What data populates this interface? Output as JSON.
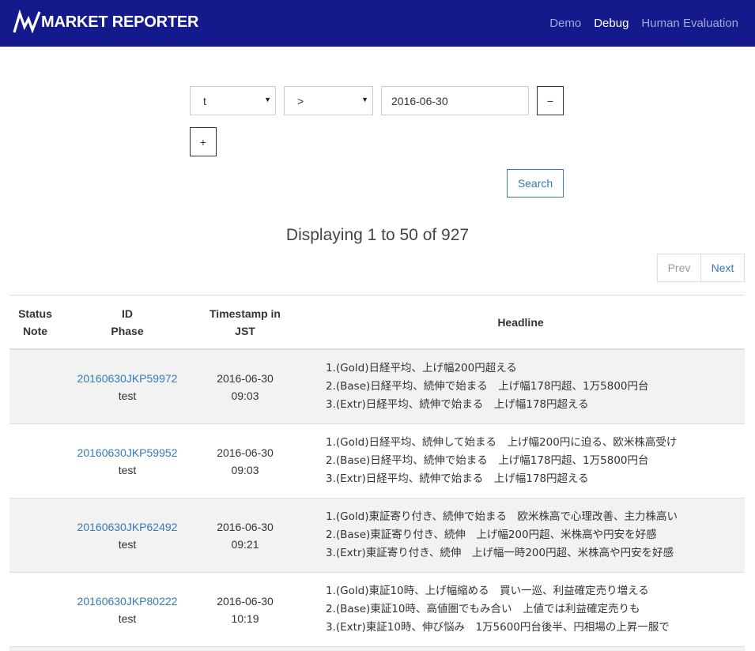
{
  "navbar": {
    "brand": "MARKET REPORTER",
    "brand_color": "#141a8c",
    "links": [
      {
        "label": "Demo"
      },
      {
        "label": "Debug"
      },
      {
        "label": "Human Evaluation"
      }
    ]
  },
  "filter": {
    "field_select": "t",
    "operator_select": ">",
    "date_value": "2016-06-30",
    "remove_label": "−",
    "add_label": "+",
    "search_label": "Search"
  },
  "results": {
    "display_text": "Displaying 1 to 50 of 927",
    "prev_label": "Prev",
    "next_label": "Next"
  },
  "table": {
    "headers": {
      "status": "Status",
      "note": "Note",
      "id": "ID",
      "phase": "Phase",
      "ts1": "Timestamp in",
      "ts2": "JST",
      "headline": "Headline"
    },
    "rows": [
      {
        "id": "20160630JKP59972",
        "phase": "test",
        "date": "2016-06-30",
        "time": "09:03",
        "headlines": [
          "1.(Gold)日経平均、上げ幅200円超える",
          "2.(Base)日経平均、続伸で始まる　上げ幅178円超、1万5800円台",
          "3.(Extr)日経平均、続伸で始まる　上げ幅178円超える"
        ]
      },
      {
        "id": "20160630JKP59952",
        "phase": "test",
        "date": "2016-06-30",
        "time": "09:03",
        "headlines": [
          "1.(Gold)日経平均、続伸して始まる　上げ幅200円に迫る、欧米株高受け",
          "2.(Base)日経平均、続伸で始まる　上げ幅178円超、1万5800円台",
          "3.(Extr)日経平均、続伸で始まる　上げ幅178円超える"
        ]
      },
      {
        "id": "20160630JKP62492",
        "phase": "test",
        "date": "2016-06-30",
        "time": "09:21",
        "headlines": [
          "1.(Gold)東証寄り付き、続伸で始まる　欧米株高で心理改善、主力株高い",
          "2.(Base)東証寄り付き、続伸　上げ幅200円超、米株高や円安を好感",
          "3.(Extr)東証寄り付き、続伸　上げ幅一時200円超、米株高や円安を好感"
        ]
      },
      {
        "id": "20160630JKP80222",
        "phase": "test",
        "date": "2016-06-30",
        "time": "10:19",
        "headlines": [
          "1.(Gold)東証10時、上げ幅縮める　買い一巡、利益確定売り増える",
          "2.(Base)東証10時、高値圏でもみ合い　上値では利益確定売りも",
          "3.(Extr)東証10時、伸び悩み　1万5600円台後半、円相場の上昇一服で"
        ]
      }
    ]
  }
}
